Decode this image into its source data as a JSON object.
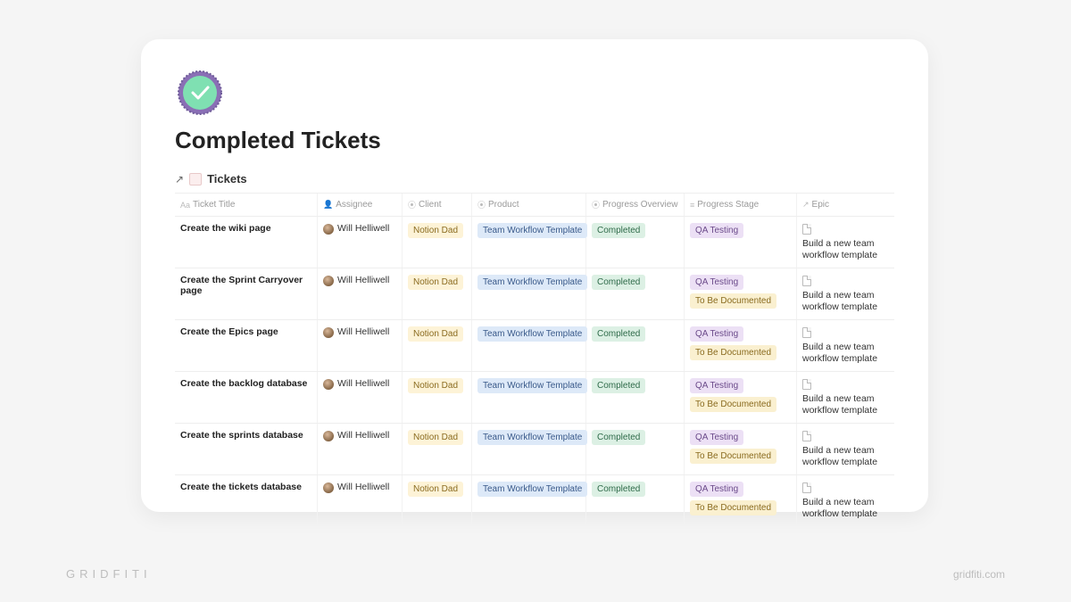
{
  "page": {
    "title": "Completed Tickets"
  },
  "database_link": {
    "label": "Tickets"
  },
  "columns": {
    "title": "Ticket Title",
    "assignee": "Assignee",
    "client": "Client",
    "product": "Product",
    "progress": "Progress Overview",
    "stage": "Progress Stage",
    "epic": "Epic"
  },
  "rows": [
    {
      "title": "Create the wiki page",
      "assignee": "Will Helliwell",
      "client": "Notion Dad",
      "product": "Team Workflow Template",
      "progress": "Completed",
      "stages": [
        "QA Testing"
      ],
      "epic": "Build a new team workflow template"
    },
    {
      "title": "Create the Sprint Carryover page",
      "assignee": "Will Helliwell",
      "client": "Notion Dad",
      "product": "Team Workflow Template",
      "progress": "Completed",
      "stages": [
        "QA Testing",
        "To Be Documented"
      ],
      "epic": "Build a new team workflow template"
    },
    {
      "title": "Create the Epics page",
      "assignee": "Will Helliwell",
      "client": "Notion Dad",
      "product": "Team Workflow Template",
      "progress": "Completed",
      "stages": [
        "QA Testing",
        "To Be Documented"
      ],
      "epic": "Build a new team workflow template"
    },
    {
      "title": "Create the backlog database",
      "assignee": "Will Helliwell",
      "client": "Notion Dad",
      "product": "Team Workflow Template",
      "progress": "Completed",
      "stages": [
        "QA Testing",
        "To Be Documented"
      ],
      "epic": "Build a new team workflow template"
    },
    {
      "title": "Create the sprints database",
      "assignee": "Will Helliwell",
      "client": "Notion Dad",
      "product": "Team Workflow Template",
      "progress": "Completed",
      "stages": [
        "QA Testing",
        "To Be Documented"
      ],
      "epic": "Build a new team workflow template"
    },
    {
      "title": "Create the tickets database",
      "assignee": "Will Helliwell",
      "client": "Notion Dad",
      "product": "Team Workflow Template",
      "progress": "Completed",
      "stages": [
        "QA Testing",
        "To Be Documented"
      ],
      "epic": "Build a new team workflow template"
    }
  ],
  "stage_colors": {
    "QA Testing": "purple",
    "To Be Documented": "yellow2"
  },
  "footer": {
    "left": "GRIDFITI",
    "right": "gridfiti.com"
  }
}
